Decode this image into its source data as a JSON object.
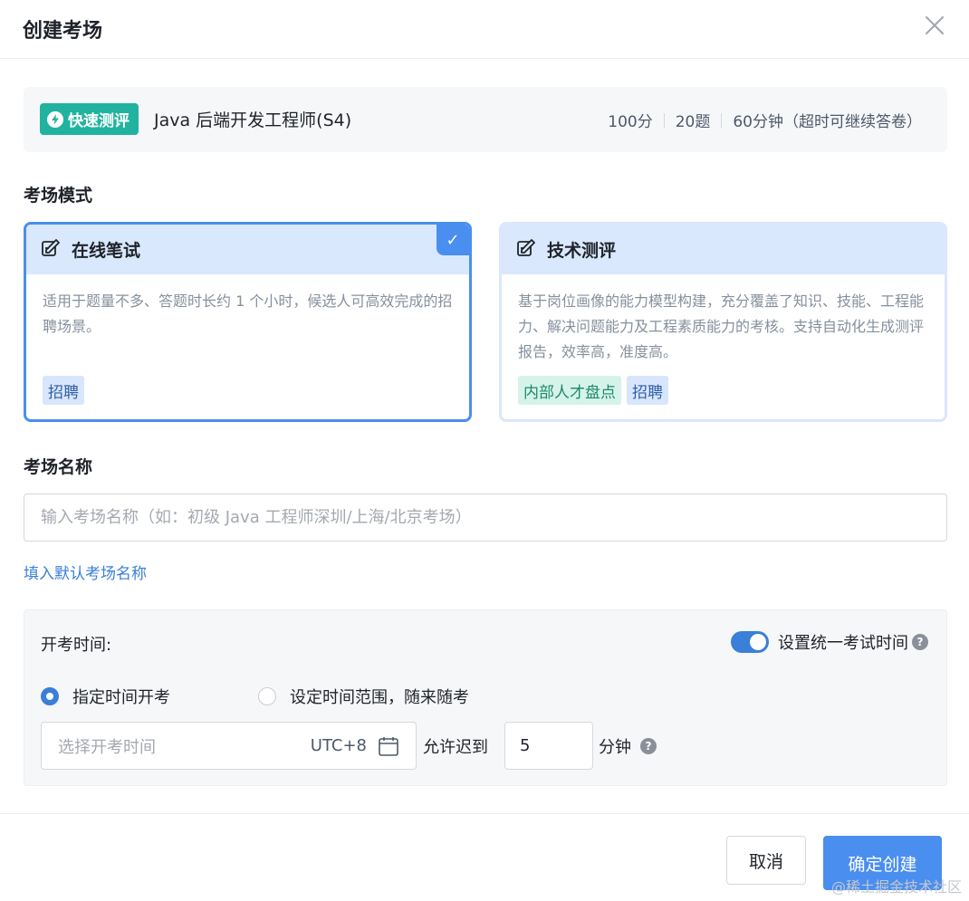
{
  "dialog": {
    "title": "创建考场"
  },
  "exam": {
    "badge": "快速测评",
    "title": "Java 后端开发工程师(S4)",
    "score": "100分",
    "questions": "20题",
    "duration": "60分钟（超时可继续答卷）"
  },
  "mode": {
    "label": "考场模式",
    "options": [
      {
        "name": "在线笔试",
        "desc": "适用于题量不多、答题时长约 1 个小时，候选人可高效完成的招聘场景。",
        "tags": [
          "招聘"
        ],
        "selected": true
      },
      {
        "name": "技术测评",
        "desc": "基于岗位画像的能力模型构建，充分覆盖了知识、技能、工程能力、解决问题能力及工程素质能力的考核。支持自动化生成测评报告，效率高，准度高。",
        "tags": [
          "内部人才盘点",
          "招聘"
        ],
        "selected": false
      }
    ],
    "selected_check": "✓"
  },
  "name_section": {
    "label": "考场名称",
    "input_value": "",
    "placeholder": "输入考场名称（如：初级 Java 工程师深圳/上海/北京考场）",
    "fill_default": "填入默认考场名称"
  },
  "time_section": {
    "label": "开考时间:",
    "unified_switch_label": "设置统一考试时间",
    "unified_switch_on": true,
    "radio_fixed": "指定时间开考",
    "radio_range": "设定时间范围，随来随考",
    "date_placeholder": "选择开考时间",
    "timezone": "UTC+8",
    "late_label": "允许迟到",
    "late_value": "5",
    "late_unit": "分钟",
    "help_icon": "?"
  },
  "footer": {
    "cancel": "取消",
    "confirm": "确定创建"
  },
  "watermark": "@稀土掘金技术社区",
  "colors": {
    "primary": "#4a8ef0",
    "fast_tag": "#21b3a0",
    "card_header": "#d9e8fd"
  }
}
